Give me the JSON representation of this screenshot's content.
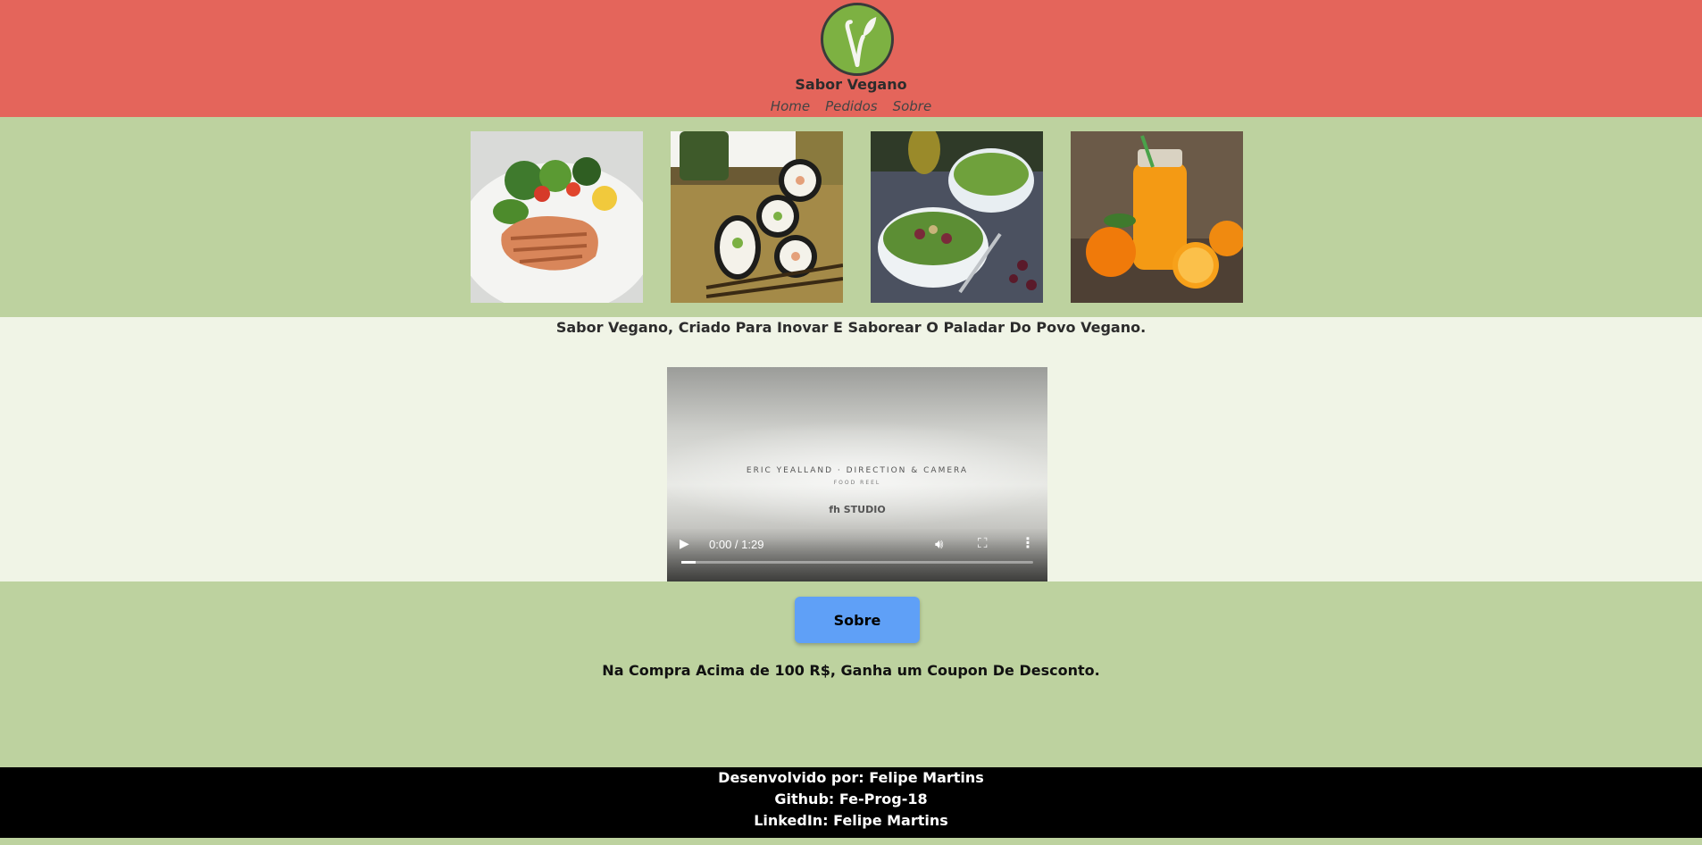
{
  "header": {
    "brand": "Sabor Vegano",
    "nav": [
      "Home",
      "Pedidos",
      "Sobre"
    ],
    "logo_icon": "vegan-sprout-icon",
    "background": "#e4655b"
  },
  "gallery": {
    "images": [
      {
        "name": "salmon-salad-photo"
      },
      {
        "name": "sushi-rolls-photo"
      },
      {
        "name": "salad-bowls-photo"
      },
      {
        "name": "orange-juice-photo"
      }
    ]
  },
  "intro": {
    "tagline": "Sabor Vegano, Criado Para Inovar E Saborear O Paladar Do Povo Vegano."
  },
  "video": {
    "title": "ERIC YEALLAND · DIRECTION & CAMERA",
    "subtitle": "FOOD REEL",
    "logo": "fh STUDIO",
    "time": "0:00 / 1:29",
    "progress": 0.04
  },
  "promo": {
    "button_label": "Sobre",
    "text": "Na Compra Acima de 100 R$, Ganha um Coupon De Desconto.",
    "button_color": "#5fa0f7"
  },
  "footer": {
    "developer": "Desenvolvido por: Felipe Martins",
    "github": "Github: Fe-Prog-18",
    "linkedin": "LinkedIn: Felipe Martins"
  }
}
